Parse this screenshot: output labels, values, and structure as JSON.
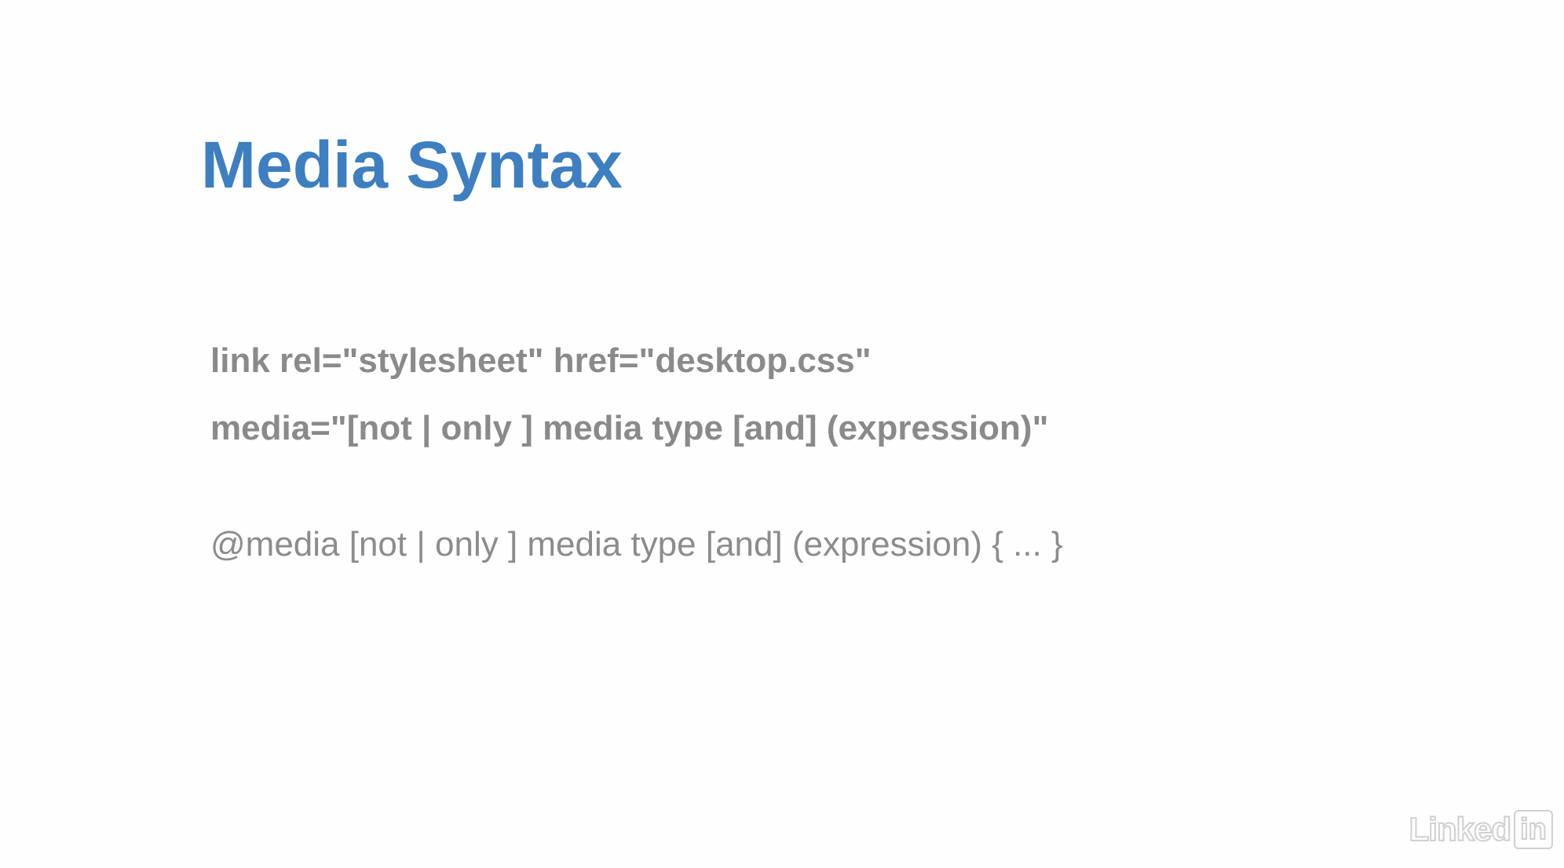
{
  "slide": {
    "title": "Media Syntax",
    "title_color": "#3d7fc0",
    "text_color": "#8a8a8a",
    "lines": [
      "link rel=\"stylesheet\" href=\"desktop.css\"",
      "media=\"[not | only ] media type [and] (expression)\"",
      "@media [not | only ] media type [and] (expression) { ... }"
    ]
  },
  "watermark": {
    "brand_text": "Linked",
    "brand_box": "in"
  }
}
